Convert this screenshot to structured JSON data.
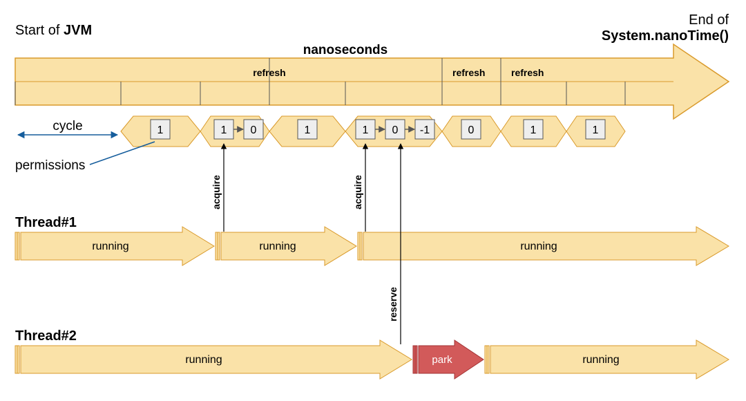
{
  "header": {
    "start_prefix": "Start of ",
    "start_bold": "JVM",
    "end_prefix": "End of",
    "end_bold": "System.nanoTime()",
    "unit": "nanoseconds"
  },
  "refresh_label": "refresh",
  "cycle_label": "cycle",
  "permissions_label": "permissions",
  "cycles": [
    {
      "values": [
        "1"
      ]
    },
    {
      "values": [
        "1",
        "0"
      ]
    },
    {
      "values": [
        "1"
      ]
    },
    {
      "values": [
        "1",
        "0",
        "-1"
      ]
    },
    {
      "values": [
        "0"
      ]
    },
    {
      "values": [
        "1"
      ]
    },
    {
      "values": [
        "1"
      ]
    }
  ],
  "acquire_label": "acquire",
  "reserve_label": "reserve",
  "thread1": {
    "title": "Thread#1",
    "segments": [
      "running",
      "running",
      "running"
    ]
  },
  "thread2": {
    "title": "Thread#2",
    "segments_run": "running",
    "park": "park"
  },
  "colors": {
    "fill_light": "#fae2a8",
    "stroke_orange": "#d99a2b",
    "blue": "#155d9c",
    "box_fill": "#eeeeee",
    "park_fill": "#d25a5a",
    "park_stroke": "#a23334"
  }
}
